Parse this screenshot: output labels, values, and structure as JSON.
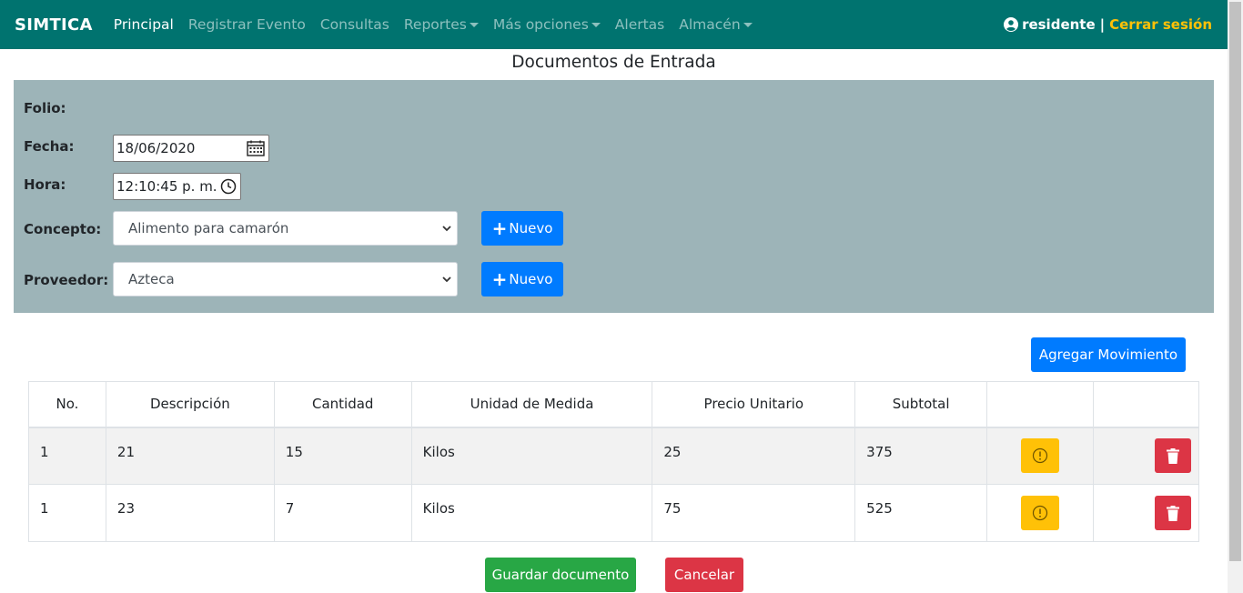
{
  "navbar": {
    "brand": "SIMTICA",
    "items": [
      {
        "label": "Principal",
        "dropdown": false,
        "active": true
      },
      {
        "label": "Registrar Evento",
        "dropdown": false,
        "active": false
      },
      {
        "label": "Consultas",
        "dropdown": false,
        "active": false
      },
      {
        "label": "Reportes",
        "dropdown": true,
        "active": false
      },
      {
        "label": "Más opciones",
        "dropdown": true,
        "active": false
      },
      {
        "label": "Alertas",
        "dropdown": false,
        "active": false
      },
      {
        "label": "Almacén",
        "dropdown": true,
        "active": false
      }
    ],
    "user": "residente",
    "separator": "|",
    "logout": "Cerrar sesión"
  },
  "page": {
    "title": "Documentos de Entrada"
  },
  "form": {
    "folio_label": "Folio:",
    "fecha_label": "Fecha:",
    "fecha_value": "18/06/2020",
    "hora_label": "Hora:",
    "hora_value": "12:10:45 p. m.",
    "concepto_label": "Concepto:",
    "concepto_value": "Alimento para camarón",
    "proveedor_label": "Proveedor:",
    "proveedor_value": "Azteca",
    "new_label": "Nuevo"
  },
  "actions": {
    "add_movement": "Agregar Movimiento",
    "save": "Guardar documento",
    "cancel": "Cancelar"
  },
  "table": {
    "headers": [
      "No.",
      "Descripción",
      "Cantidad",
      "Unidad de Medida",
      "Precio Unitario",
      "Subtotal",
      "",
      ""
    ],
    "rows": [
      {
        "no": "1",
        "descripcion": "21",
        "cantidad": "15",
        "unidad": "Kilos",
        "precio": "25",
        "subtotal": "375"
      },
      {
        "no": "1",
        "descripcion": "23",
        "cantidad": "7",
        "unidad": "Kilos",
        "precio": "75",
        "subtotal": "525"
      }
    ]
  },
  "colors": {
    "navbar": "#00736f",
    "panel": "#9db4b8",
    "primary": "#007bff",
    "success": "#28a745",
    "danger": "#dc3545",
    "warning": "#ffc107",
    "logout": "#ffc107"
  },
  "icons": {
    "user": "user-circle-icon",
    "calendar": "calendar-icon",
    "clock": "clock-icon",
    "plus": "plus-icon",
    "warning": "exclamation-circle-icon",
    "delete": "trash-icon",
    "dropdown": "chevron-down-icon"
  }
}
